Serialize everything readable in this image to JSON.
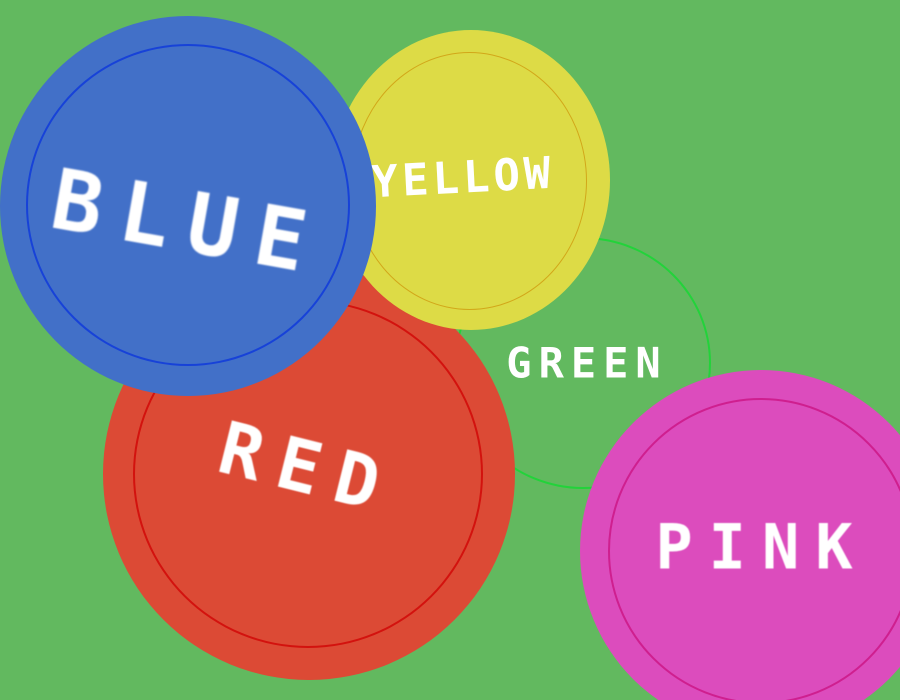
{
  "circles": {
    "blue": {
      "label": "BLUE",
      "color": "#4270c8",
      "ring_color": "#1742d8"
    },
    "yellow": {
      "label": "YELLOW",
      "color": "#dddb46",
      "ring_color": "#d2a719"
    },
    "green": {
      "label": "GREEN",
      "color": "#62b95f",
      "ring_color": "#22d33a"
    },
    "red": {
      "label": "RED",
      "color": "#dc4a35",
      "ring_color": "#d3120e"
    },
    "pink": {
      "label": "PINK",
      "color": "#dc4cbd",
      "ring_color": "#cf1f8f"
    }
  },
  "background_color": "#62b95f"
}
